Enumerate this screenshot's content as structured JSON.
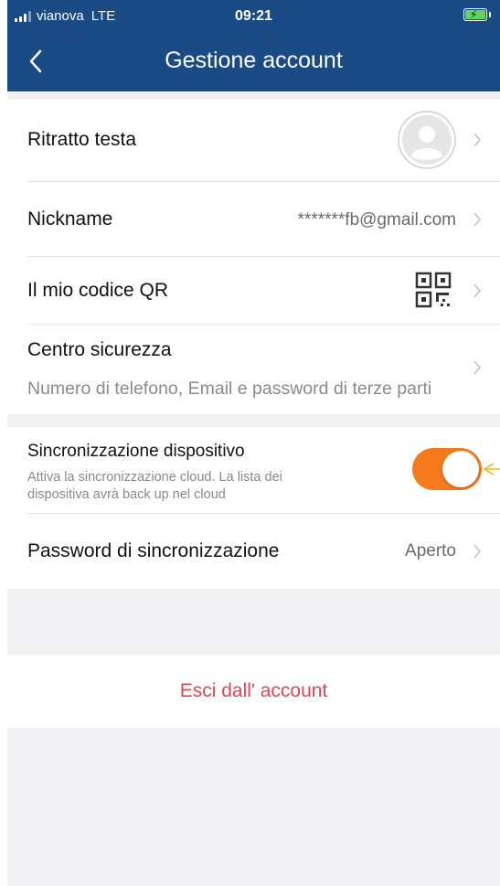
{
  "status_bar": {
    "carrier": "vianova",
    "network": "LTE",
    "time": "09:21"
  },
  "nav": {
    "back_icon": "chevron-left-icon",
    "title": "Gestione account"
  },
  "rows": {
    "avatar": {
      "label": "Ritratto testa",
      "icon": "avatar-placeholder-icon"
    },
    "nickname": {
      "label": "Nickname",
      "value": "*******fb@gmail.com"
    },
    "qr": {
      "label": "Il mio codice QR",
      "icon": "qr-code-icon"
    },
    "security": {
      "label": "Centro sicurezza",
      "subtitle": "Numero di telefono, Email e password di terze parti"
    },
    "sync": {
      "label": "Sincronizzazione dispositivo",
      "description_line1": "Attiva la sincronizzazione cloud. La lista dei",
      "description_line2": "dispositiva avrà back up nel cloud",
      "enabled": true
    },
    "sync_password": {
      "label": "Password di sincronizzazione",
      "value": "Aperto"
    }
  },
  "logout": {
    "label": "Esci dall' account"
  },
  "colors": {
    "header": "#1a4b85",
    "toggle_on": "#f57a1c",
    "logout": "#e0464e",
    "background": "#f2f2f4"
  }
}
